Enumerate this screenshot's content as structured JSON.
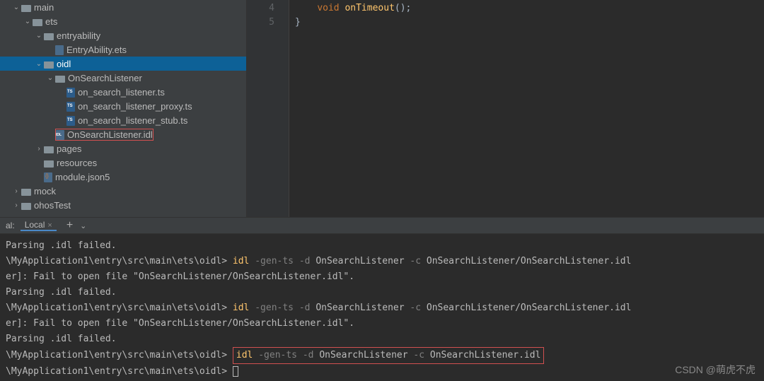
{
  "tree": {
    "main": "main",
    "ets": "ets",
    "entryability": "entryability",
    "entryability_file": "EntryAbility.ets",
    "oidl": "oidl",
    "onsearchlistener": "OnSearchListener",
    "listener_ts": "on_search_listener.ts",
    "proxy_ts": "on_search_listener_proxy.ts",
    "stub_ts": "on_search_listener_stub.ts",
    "idl_file": "OnSearchListener.idl",
    "pages": "pages",
    "resources": "resources",
    "module_json": "module.json5",
    "mock": "mock",
    "ohostest": "ohosTest"
  },
  "editor": {
    "lines": [
      "4",
      "5"
    ],
    "kw_void": "void",
    "method": "onTimeout",
    "parens": "();",
    "close_brace": "}"
  },
  "termheader": {
    "prefix": "al:",
    "tab": "Local",
    "plus": "+",
    "chev": "⌄"
  },
  "terminal": {
    "err_parse": " Parsing .idl failed.",
    "prompt": "\\MyApplication1\\entry\\src\\main\\ets\\oidl>",
    "cmd": "idl",
    "flags1": "-gen-ts -d",
    "arg1": "OnSearchListener",
    "flag_c": "-c",
    "arg2": "OnSearchListener/OnSearchListener.idl",
    "err_open": "er]: Fail to open file \"OnSearchListener/OnSearchListener.idl\".",
    "final_arg": "OnSearchListener.idl"
  },
  "watermark": "CSDN @萌虎不虎"
}
